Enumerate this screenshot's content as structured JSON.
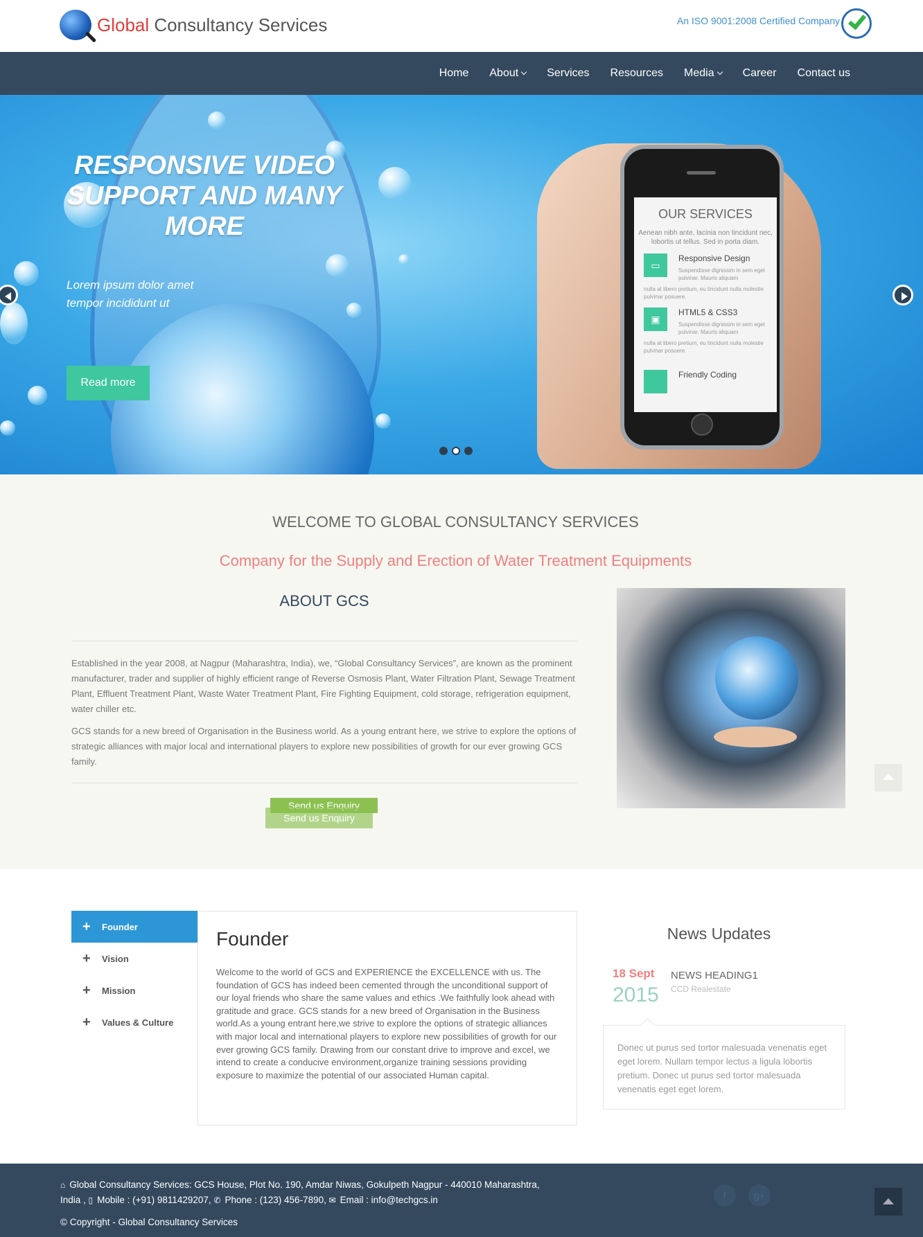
{
  "header": {
    "logo_primary": "Global",
    "logo_secondary": "Consultancy Services",
    "iso_text": "An ISO 9001:2008 Certified Company"
  },
  "nav": {
    "items": [
      {
        "label": "Home",
        "dropdown": false
      },
      {
        "label": "About",
        "dropdown": true
      },
      {
        "label": "Services",
        "dropdown": false
      },
      {
        "label": "Resources",
        "dropdown": false
      },
      {
        "label": "Media",
        "dropdown": true
      },
      {
        "label": "Career",
        "dropdown": false
      },
      {
        "label": "Contact us",
        "dropdown": false
      }
    ]
  },
  "hero": {
    "title": "RESPONSIVE VIDEO SUPPORT AND MANY MORE",
    "subtitle_line1": "Lorem ipsum dolor amet",
    "subtitle_line2": "tempor incididunt ut",
    "button": "Read more",
    "slide_count": 3,
    "active_slide": 2,
    "phone": {
      "heading": "OUR SERVICES",
      "intro": "Aenean nibh ante, lacinia non tincidunt nec, lobortis ut tellus. Sed in porta diam.",
      "services": [
        {
          "title": "Responsive Design",
          "text_a": "Suspendisse dignissim in sem eget pulvinar. Mauris aliquam",
          "text_b": "nulla at libero pretium, eu tincidunt nulla molestie pulvinar posuere.",
          "icon": "monitor-icon"
        },
        {
          "title": "HTML5 & CSS3",
          "text_a": "Suspendisse dignissim in sem eget pulvinar. Mauris aliquam",
          "text_b": "nulla at libero pretium, eu tincidunt nulla molestie pulvinar posuere.",
          "icon": "gift-icon"
        },
        {
          "title": "Friendly Coding",
          "icon": "code-icon"
        }
      ]
    }
  },
  "welcome": {
    "heading": "WELCOME TO GLOBAL CONSULTANCY SERVICES",
    "tagline": "Company for the Supply and Erection of Water Treatment Equipments",
    "about_title": "ABOUT GCS",
    "para1": "Established in the year 2008, at Nagpur (Maharashtra, India), we, “Global Consultancy Services”, are known as the prominent manufacturer, trader and supplier of highly efficient range of Reverse Osmosis Plant, Water Filtration Plant, Sewage Treatment Plant, Effluent Treatment Plant, Waste Water Treatment Plant, Fire Fighting Equipment, cold storage, refrigeration equipment, water chiller etc.",
    "para2": "GCS stands for a new breed of Organisation in the Business world. As a young entrant here, we strive to explore the options of strategic alliances with major local and international players to explore new possibilities of growth for our ever growing GCS family.",
    "enquiry_btn": "Send us Enquiry"
  },
  "tabs": {
    "items": [
      {
        "label": "Founder",
        "active": true
      },
      {
        "label": "Vision",
        "active": false
      },
      {
        "label": "Mission",
        "active": false
      },
      {
        "label": "Values & Culture",
        "active": false
      }
    ],
    "panel_title": "Founder",
    "panel_text": "Welcome to the world of GCS and EXPERIENCE the EXCELLENCE with us. The foundation of GCS has indeed been cemented through the unconditional support of our loyal friends who share the same values and ethics .We faithfully look ahead with gratitude and grace. GCS stands for a new breed of Organisation in the Business world.As a young entrant here,we strive to explore the options of strategic alliances with major local and international players to explore new possibilities of growth for our ever growing GCS family. Drawing from our constant drive to improve and excel, we intend to create a conducive environment,organize training sessions providing exposure to maximize the potential of our associated Human capital."
  },
  "news": {
    "title": "News Updates",
    "date": "18 Sept",
    "year": "2015",
    "heading": "NEWS HEADING1",
    "sub": "CCD Realestate",
    "text": "Donec ut purus sed tortor malesuada venenatis eget eget lorem. Nullam tempor lectus a ligula lobortis pretium. Donec ut purus sed tortor malesuada venenatis eget eget lorem."
  },
  "footer": {
    "address_line1": "Global Consultancy Services: GCS House, Plot No. 190, Amdar Niwas, Gokulpeth Nagpur - 440010 Maharashtra,",
    "address_line2_prefix": "India ,",
    "mobile": "Mobile : (+91) 9811429207,",
    "phone": "Phone : (123) 456-7890,",
    "email": "Email : info@techgcs.in",
    "copyright": "© Copyright - Global Consultancy Services"
  },
  "colors": {
    "nav_bg": "#34495e",
    "accent_green": "#3fc79e",
    "accent_red": "#f08080",
    "tab_active": "#2d96d6"
  }
}
